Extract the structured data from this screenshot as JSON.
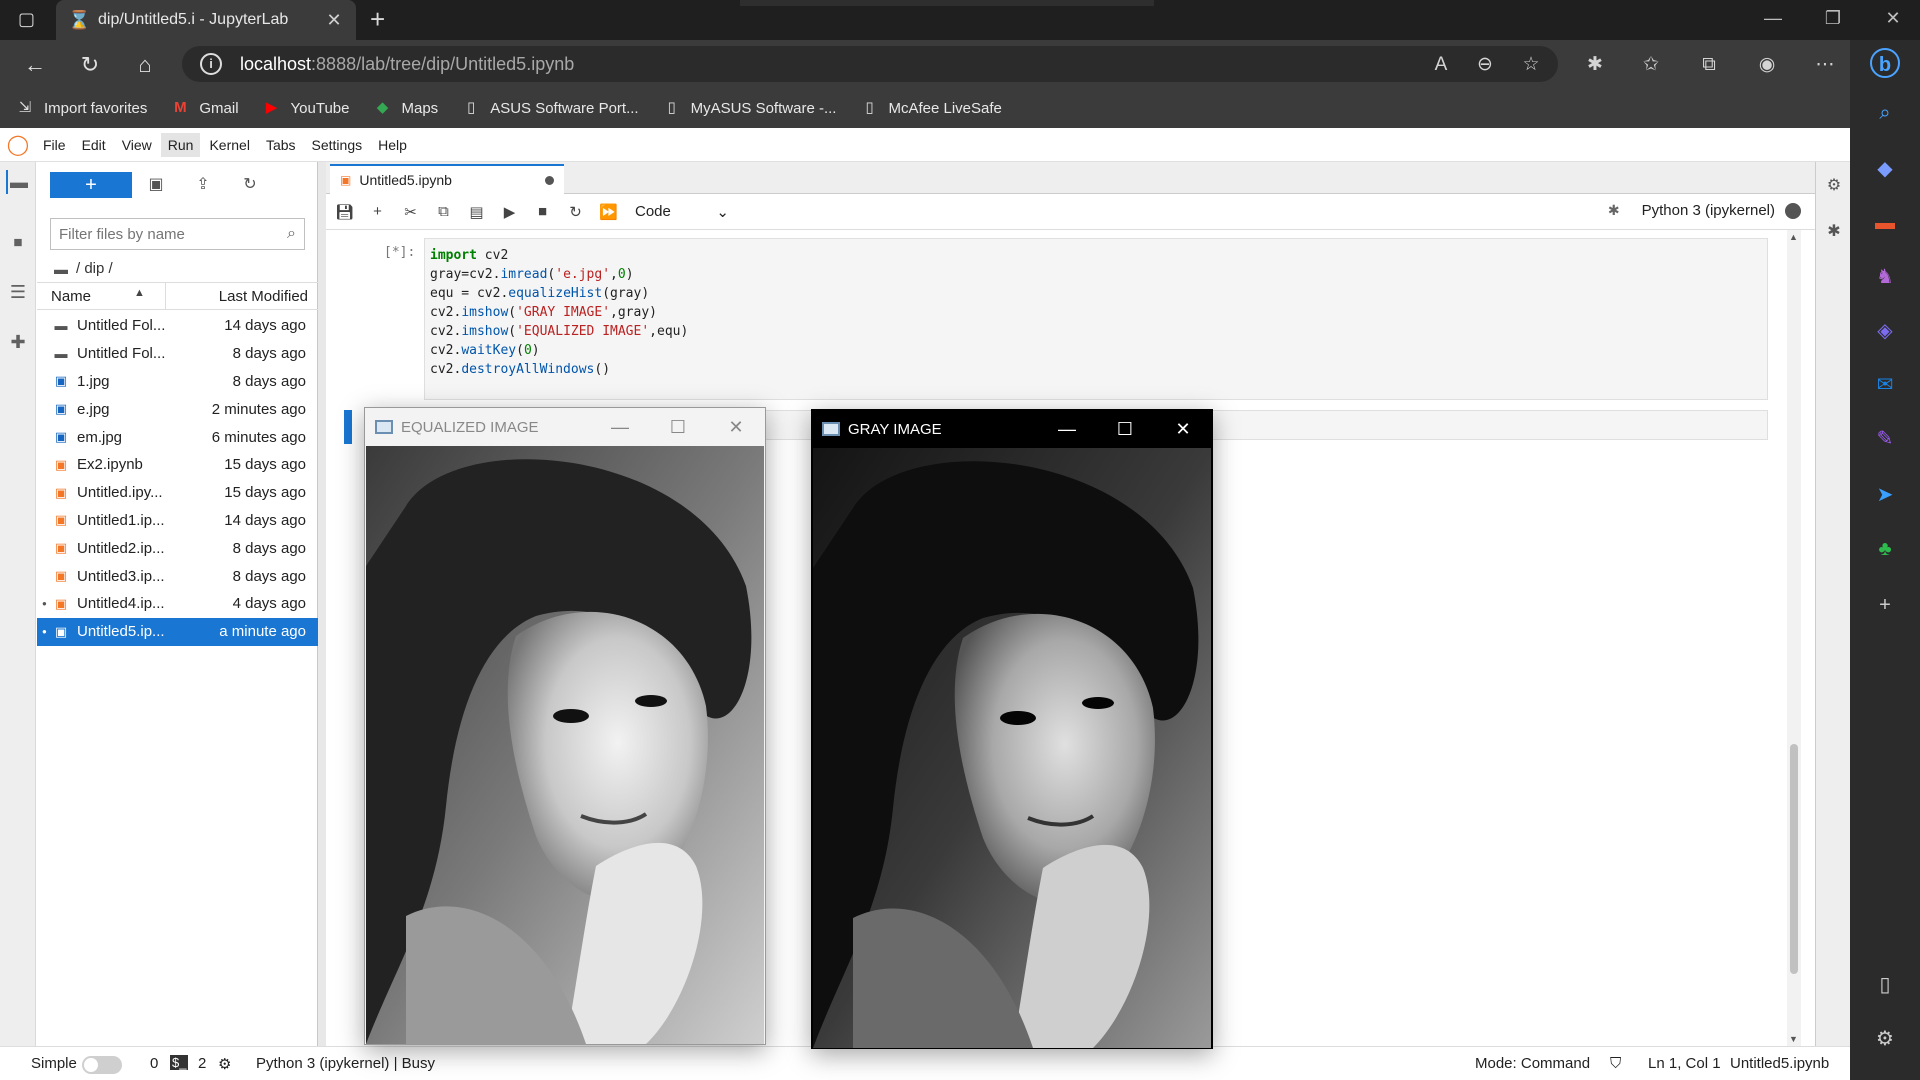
{
  "browser": {
    "tab_title": "dip/Untitled5.i - JupyterLab",
    "new_tab": "+",
    "url_host": "localhost",
    "url_path": ":8888/lab/tree/dip/Untitled5.ipynb",
    "bookmarks": [
      {
        "label": "Import favorites",
        "icon": "import-icon"
      },
      {
        "label": "Gmail",
        "icon": "gmail-icon"
      },
      {
        "label": "YouTube",
        "icon": "youtube-icon"
      },
      {
        "label": "Maps",
        "icon": "maps-icon"
      },
      {
        "label": "ASUS Software Port...",
        "icon": "page-icon"
      },
      {
        "label": "MyASUS Software -...",
        "icon": "page-icon"
      },
      {
        "label": "McAfee LiveSafe",
        "icon": "page-icon"
      }
    ]
  },
  "jupyter": {
    "menu": [
      "File",
      "Edit",
      "View",
      "Run",
      "Kernel",
      "Tabs",
      "Settings",
      "Help"
    ],
    "active_menu": "Run",
    "filebrowser": {
      "new_button": "+",
      "filter_placeholder": "Filter files by name",
      "breadcrumb": "/ dip /",
      "col_name": "Name",
      "col_modified": "Last Modified",
      "files": [
        {
          "name": "Untitled Fol...",
          "modified": "14 days ago",
          "type": "folder",
          "running": false,
          "selected": false
        },
        {
          "name": "Untitled Fol...",
          "modified": "8 days ago",
          "type": "folder",
          "running": false,
          "selected": false
        },
        {
          "name": "1.jpg",
          "modified": "8 days ago",
          "type": "image",
          "running": false,
          "selected": false
        },
        {
          "name": "e.jpg",
          "modified": "2 minutes ago",
          "type": "image",
          "running": false,
          "selected": false
        },
        {
          "name": "em.jpg",
          "modified": "6 minutes ago",
          "type": "image",
          "running": false,
          "selected": false
        },
        {
          "name": "Ex2.ipynb",
          "modified": "15 days ago",
          "type": "notebook",
          "running": false,
          "selected": false
        },
        {
          "name": "Untitled.ipy...",
          "modified": "15 days ago",
          "type": "notebook",
          "running": false,
          "selected": false
        },
        {
          "name": "Untitled1.ip...",
          "modified": "14 days ago",
          "type": "notebook",
          "running": false,
          "selected": false
        },
        {
          "name": "Untitled2.ip...",
          "modified": "8 days ago",
          "type": "notebook",
          "running": false,
          "selected": false
        },
        {
          "name": "Untitled3.ip...",
          "modified": "8 days ago",
          "type": "notebook",
          "running": false,
          "selected": false
        },
        {
          "name": "Untitled4.ip...",
          "modified": "4 days ago",
          "type": "notebook",
          "running": true,
          "selected": false
        },
        {
          "name": "Untitled5.ip...",
          "modified": "a minute ago",
          "type": "notebook",
          "running": true,
          "selected": true
        }
      ]
    },
    "notebook": {
      "tab_title": "Untitled5.ipynb",
      "cell_type": "Code",
      "kernel": "Python 3 (ipykernel)",
      "cell1_prompt": "[*]:",
      "cell1_code": [
        "import cv2",
        "gray=cv2.imread('e.jpg',0)",
        "equ = cv2.equalizeHist(gray)",
        "cv2.imshow('GRAY IMAGE',gray)",
        "cv2.imshow('EQUALIZED IMAGE',equ)",
        "cv2.waitKey(0)",
        "cv2.destroyAllWindows()"
      ]
    },
    "status": {
      "mode_label": "Simple",
      "terminals": "0",
      "kernels": "2",
      "kernel_state": "Python 3 (ipykernel) | Busy",
      "mode": "Mode: Command",
      "cursor": "Ln 1, Col 1",
      "file": "Untitled5.ipynb"
    }
  },
  "cv_windows": {
    "equalized_title": "EQUALIZED IMAGE",
    "gray_title": "GRAY IMAGE"
  }
}
